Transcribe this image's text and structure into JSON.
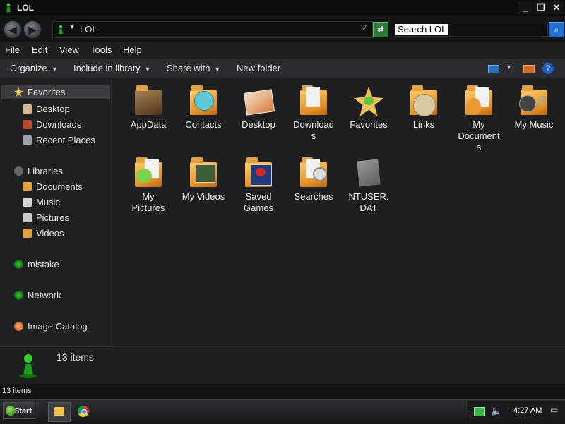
{
  "window": {
    "title": "LOL",
    "controls": [
      "_",
      "❐",
      "✕"
    ]
  },
  "address": {
    "path": "LOL",
    "search_placeholder": "Search LOL",
    "back_label": "◀",
    "forward_label": "▶",
    "refresh_label": "⇄",
    "search_label": "⌕"
  },
  "menu": [
    "File",
    "Edit",
    "View",
    "Tools",
    "Help"
  ],
  "commands": {
    "organize": "Organize",
    "include": "Include in library",
    "share": "Share with",
    "new_folder": "New folder",
    "help": "?"
  },
  "nav": {
    "favorites": "Favorites",
    "favorites_items": [
      "Desktop",
      "Downloads",
      "Recent Places"
    ],
    "libraries": "Libraries",
    "libraries_items": [
      "Documents",
      "Music",
      "Pictures",
      "Videos"
    ],
    "homegroup": "mistake",
    "network": "Network",
    "image_catalog": "Image Catalog"
  },
  "files": [
    {
      "label": "AppData",
      "icon": "folder-icon"
    },
    {
      "label": "Contacts",
      "icon": "folder-contacts-icon"
    },
    {
      "label": "Desktop",
      "icon": "desktop-folder-icon"
    },
    {
      "label": "Download\ns",
      "icon": "folder-downloads-icon"
    },
    {
      "label": "Favorites",
      "icon": "favorites-star-icon"
    },
    {
      "label": "Links",
      "icon": "folder-links-icon"
    },
    {
      "label": "My\nDocument\ns",
      "icon": "folder-documents-icon"
    },
    {
      "label": "My Music",
      "icon": "folder-music-icon"
    },
    {
      "label": "My\nPictures",
      "icon": "folder-pictures-icon"
    },
    {
      "label": "My Videos",
      "icon": "folder-videos-icon"
    },
    {
      "label": "Saved\nGames",
      "icon": "folder-saved-games-icon"
    },
    {
      "label": "Searches",
      "icon": "folder-searches-icon"
    },
    {
      "label": "NTUSER.\nDAT",
      "icon": "file-icon"
    }
  ],
  "details": {
    "count": "13 items"
  },
  "status": {
    "text": "13 items"
  },
  "taskbar": {
    "start": "Start",
    "time": "4:27 AM",
    "volume": "🔈",
    "show_desktop": "▭"
  }
}
